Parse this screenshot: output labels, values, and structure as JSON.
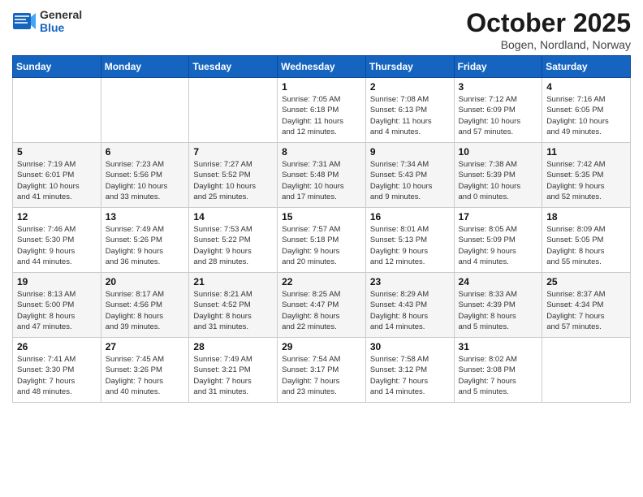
{
  "logo": {
    "line1": "General",
    "line2": "Blue"
  },
  "title": "October 2025",
  "subtitle": "Bogen, Nordland, Norway",
  "weekdays": [
    "Sunday",
    "Monday",
    "Tuesday",
    "Wednesday",
    "Thursday",
    "Friday",
    "Saturday"
  ],
  "weeks": [
    [
      {
        "day": "",
        "info": ""
      },
      {
        "day": "",
        "info": ""
      },
      {
        "day": "",
        "info": ""
      },
      {
        "day": "1",
        "info": "Sunrise: 7:05 AM\nSunset: 6:18 PM\nDaylight: 11 hours\nand 12 minutes."
      },
      {
        "day": "2",
        "info": "Sunrise: 7:08 AM\nSunset: 6:13 PM\nDaylight: 11 hours\nand 4 minutes."
      },
      {
        "day": "3",
        "info": "Sunrise: 7:12 AM\nSunset: 6:09 PM\nDaylight: 10 hours\nand 57 minutes."
      },
      {
        "day": "4",
        "info": "Sunrise: 7:16 AM\nSunset: 6:05 PM\nDaylight: 10 hours\nand 49 minutes."
      }
    ],
    [
      {
        "day": "5",
        "info": "Sunrise: 7:19 AM\nSunset: 6:01 PM\nDaylight: 10 hours\nand 41 minutes."
      },
      {
        "day": "6",
        "info": "Sunrise: 7:23 AM\nSunset: 5:56 PM\nDaylight: 10 hours\nand 33 minutes."
      },
      {
        "day": "7",
        "info": "Sunrise: 7:27 AM\nSunset: 5:52 PM\nDaylight: 10 hours\nand 25 minutes."
      },
      {
        "day": "8",
        "info": "Sunrise: 7:31 AM\nSunset: 5:48 PM\nDaylight: 10 hours\nand 17 minutes."
      },
      {
        "day": "9",
        "info": "Sunrise: 7:34 AM\nSunset: 5:43 PM\nDaylight: 10 hours\nand 9 minutes."
      },
      {
        "day": "10",
        "info": "Sunrise: 7:38 AM\nSunset: 5:39 PM\nDaylight: 10 hours\nand 0 minutes."
      },
      {
        "day": "11",
        "info": "Sunrise: 7:42 AM\nSunset: 5:35 PM\nDaylight: 9 hours\nand 52 minutes."
      }
    ],
    [
      {
        "day": "12",
        "info": "Sunrise: 7:46 AM\nSunset: 5:30 PM\nDaylight: 9 hours\nand 44 minutes."
      },
      {
        "day": "13",
        "info": "Sunrise: 7:49 AM\nSunset: 5:26 PM\nDaylight: 9 hours\nand 36 minutes."
      },
      {
        "day": "14",
        "info": "Sunrise: 7:53 AM\nSunset: 5:22 PM\nDaylight: 9 hours\nand 28 minutes."
      },
      {
        "day": "15",
        "info": "Sunrise: 7:57 AM\nSunset: 5:18 PM\nDaylight: 9 hours\nand 20 minutes."
      },
      {
        "day": "16",
        "info": "Sunrise: 8:01 AM\nSunset: 5:13 PM\nDaylight: 9 hours\nand 12 minutes."
      },
      {
        "day": "17",
        "info": "Sunrise: 8:05 AM\nSunset: 5:09 PM\nDaylight: 9 hours\nand 4 minutes."
      },
      {
        "day": "18",
        "info": "Sunrise: 8:09 AM\nSunset: 5:05 PM\nDaylight: 8 hours\nand 55 minutes."
      }
    ],
    [
      {
        "day": "19",
        "info": "Sunrise: 8:13 AM\nSunset: 5:00 PM\nDaylight: 8 hours\nand 47 minutes."
      },
      {
        "day": "20",
        "info": "Sunrise: 8:17 AM\nSunset: 4:56 PM\nDaylight: 8 hours\nand 39 minutes."
      },
      {
        "day": "21",
        "info": "Sunrise: 8:21 AM\nSunset: 4:52 PM\nDaylight: 8 hours\nand 31 minutes."
      },
      {
        "day": "22",
        "info": "Sunrise: 8:25 AM\nSunset: 4:47 PM\nDaylight: 8 hours\nand 22 minutes."
      },
      {
        "day": "23",
        "info": "Sunrise: 8:29 AM\nSunset: 4:43 PM\nDaylight: 8 hours\nand 14 minutes."
      },
      {
        "day": "24",
        "info": "Sunrise: 8:33 AM\nSunset: 4:39 PM\nDaylight: 8 hours\nand 5 minutes."
      },
      {
        "day": "25",
        "info": "Sunrise: 8:37 AM\nSunset: 4:34 PM\nDaylight: 7 hours\nand 57 minutes."
      }
    ],
    [
      {
        "day": "26",
        "info": "Sunrise: 7:41 AM\nSunset: 3:30 PM\nDaylight: 7 hours\nand 48 minutes."
      },
      {
        "day": "27",
        "info": "Sunrise: 7:45 AM\nSunset: 3:26 PM\nDaylight: 7 hours\nand 40 minutes."
      },
      {
        "day": "28",
        "info": "Sunrise: 7:49 AM\nSunset: 3:21 PM\nDaylight: 7 hours\nand 31 minutes."
      },
      {
        "day": "29",
        "info": "Sunrise: 7:54 AM\nSunset: 3:17 PM\nDaylight: 7 hours\nand 23 minutes."
      },
      {
        "day": "30",
        "info": "Sunrise: 7:58 AM\nSunset: 3:12 PM\nDaylight: 7 hours\nand 14 minutes."
      },
      {
        "day": "31",
        "info": "Sunrise: 8:02 AM\nSunset: 3:08 PM\nDaylight: 7 hours\nand 5 minutes."
      },
      {
        "day": "",
        "info": ""
      }
    ]
  ]
}
